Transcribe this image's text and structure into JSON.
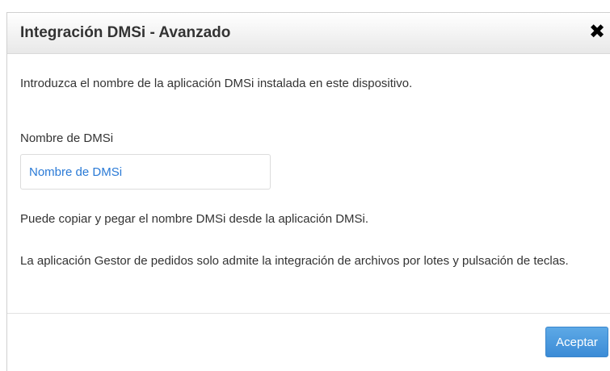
{
  "dialog": {
    "title": "Integración DMSi - Avanzado",
    "close_icon": "close-icon",
    "intro": "Introduzca el nombre de la aplicación DMSi instalada en este dispositivo.",
    "field_label": "Nombre de DMSi",
    "field_placeholder": "Nombre de DMSi",
    "field_value": "",
    "hint_copy": "Puede copiar y pegar el nombre DMSi desde la aplicación DMSi.",
    "hint_support": "La aplicación Gestor de pedidos solo admite la integración de archivos por lotes y pulsación de teclas.",
    "ok_label": "Aceptar"
  },
  "colors": {
    "accent": "#3b8bd6",
    "placeholder": "#2a7ad6",
    "text": "#333333"
  }
}
